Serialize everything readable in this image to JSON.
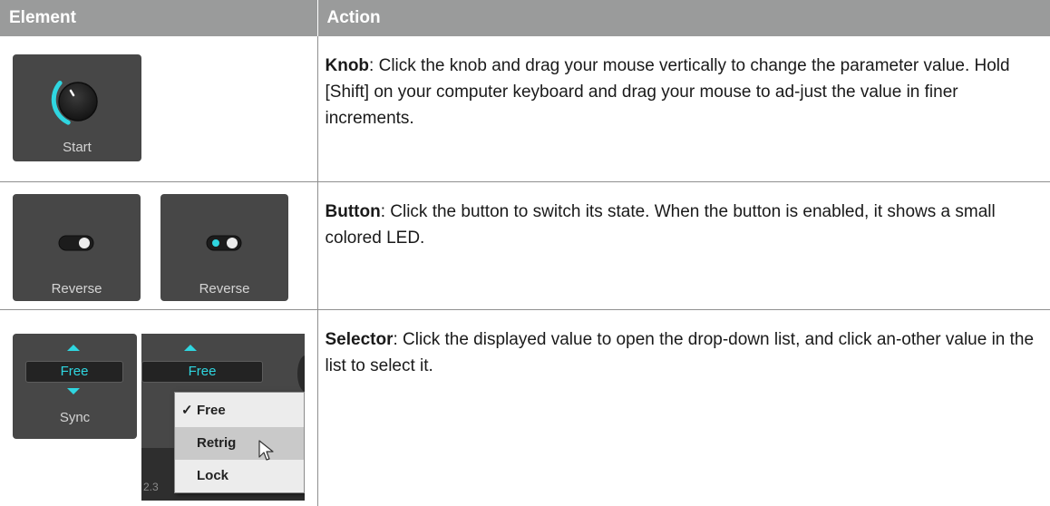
{
  "header": {
    "element": "Element",
    "action": "Action"
  },
  "rows": [
    {
      "title": "Knob",
      "text": ": Click the knob and drag your mouse vertically to change the parameter value. Hold [Shift] on your computer keyboard and drag your mouse to ad-just the value in finer increments.",
      "knob_caption": "Start"
    },
    {
      "title": "Button",
      "text": ": Click the button to switch its state. When the button is enabled, it shows a small colored LED.",
      "off_caption": "Reverse",
      "on_caption": "Reverse"
    },
    {
      "title": "Selector",
      "text": ": Click the displayed value to open the drop-down list, and click an-other value in the list to select it.",
      "value": "Free",
      "caption": "Sync",
      "open_value": "Free",
      "menu": [
        "Free",
        "Retrig",
        "Lock"
      ],
      "checked": "✓",
      "bg_number": "2.3"
    }
  ],
  "colors": {
    "accent": "#2fd6e0",
    "panel": "#474747",
    "header_bg": "#9a9b9b"
  }
}
